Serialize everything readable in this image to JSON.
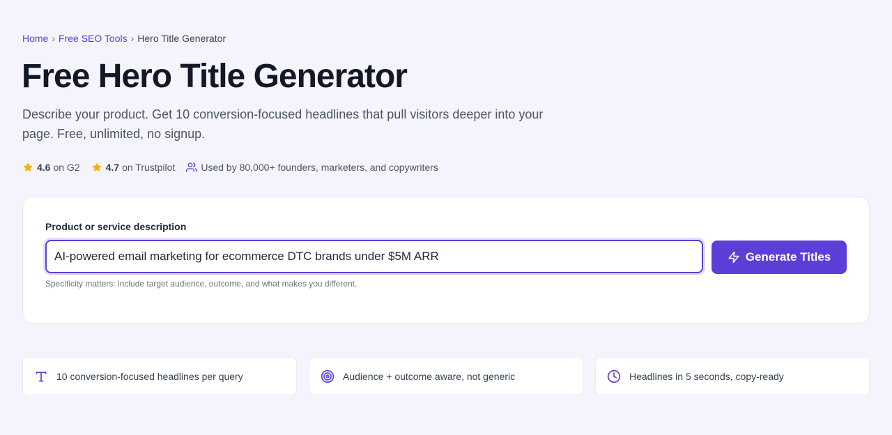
{
  "breadcrumb": {
    "home": "Home",
    "sep1": "›",
    "tools": "Free SEO Tools",
    "sep2": "›",
    "current": "Hero Title Generator"
  },
  "title": "Free Hero Title Generator",
  "subtitle": "Describe your product. Get 10 conversion-focused headlines that pull visitors deeper into your page. Free, unlimited, no signup.",
  "ratings": [
    {
      "score": "4.6",
      "source": "on G2",
      "icon": "star-icon"
    },
    {
      "score": "4.7",
      "source": "on Trustpilot",
      "icon": "star-icon"
    }
  ],
  "users_text": "Used by 80,000+ founders, marketers, and copywriters",
  "form": {
    "label": "Product or service description",
    "input_value": "AI-powered email marketing for ecommerce DTC brands under $5M ARR",
    "button_label": "Generate Titles",
    "hint": "Specificity matters: include target audience, outcome, and what makes you different."
  },
  "features": [
    {
      "icon": "text-type-icon",
      "text": "10 conversion-focused headlines per query"
    },
    {
      "icon": "target-icon",
      "text": "Audience + outcome aware, not generic"
    },
    {
      "icon": "clock-icon",
      "text": "Headlines in 5 seconds, copy-ready"
    }
  ],
  "colors": {
    "accent": "#5b3fd6",
    "star": "#f5b301",
    "background": "#f5f4fd"
  }
}
